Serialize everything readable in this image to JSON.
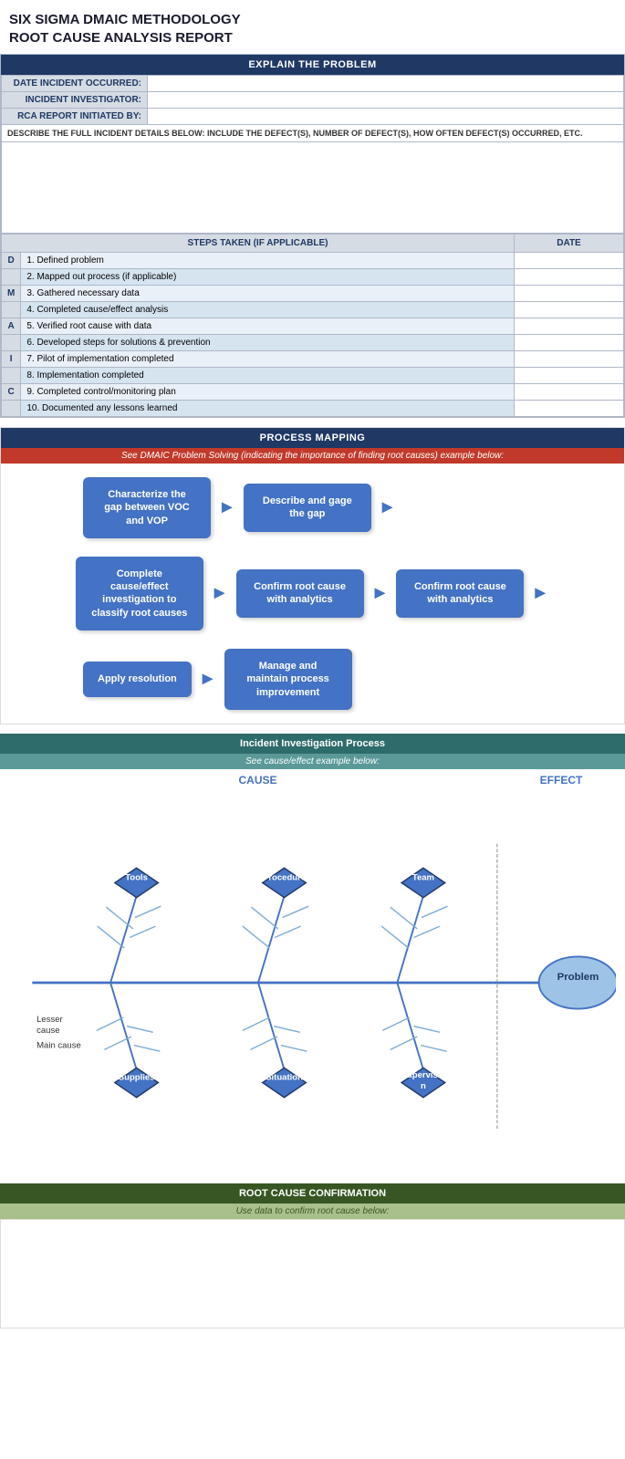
{
  "title": {
    "line1": "SIX SIGMA DMAIC METHODOLOGY",
    "line2": "ROOT CAUSE ANALYSIS REPORT"
  },
  "explain_section": {
    "header": "EXPLAIN THE PROBLEM",
    "fields": [
      {
        "label": "DATE INCIDENT OCCURRED:",
        "value": ""
      },
      {
        "label": "INCIDENT INVESTIGATOR:",
        "value": ""
      },
      {
        "label": "RCA REPORT INITIATED BY:",
        "value": ""
      }
    ],
    "description_label": "DESCRIBE THE FULL INCIDENT DETAILS BELOW: INCLUDE THE DEFECT(S), NUMBER OF DEFECT(S), HOW OFTEN DEFECT(S) OCCURRED, ETC."
  },
  "steps_section": {
    "col1": "STEPS TAKEN (IF APPLICABLE)",
    "col2": "DATE",
    "steps": [
      {
        "phase": "D",
        "text": "1. Defined problem",
        "date": ""
      },
      {
        "phase": "",
        "text": "2. Mapped out process (if applicable)",
        "date": ""
      },
      {
        "phase": "M",
        "text": "3. Gathered necessary data",
        "date": ""
      },
      {
        "phase": "",
        "text": "4. Completed cause/effect analysis",
        "date": ""
      },
      {
        "phase": "A",
        "text": "5. Verified root cause with data",
        "date": ""
      },
      {
        "phase": "",
        "text": "6. Developed steps for solutions & prevention",
        "date": ""
      },
      {
        "phase": "I",
        "text": "7. Pilot of implementation completed",
        "date": ""
      },
      {
        "phase": "",
        "text": "8. Implementation completed",
        "date": ""
      },
      {
        "phase": "C",
        "text": "9. Completed control/monitoring plan",
        "date": ""
      },
      {
        "phase": "",
        "text": "10. Documented any lessons learned",
        "date": ""
      }
    ]
  },
  "process_mapping": {
    "header": "PROCESS MAPPING",
    "subheader": "See DMAIC Problem Solving (indicating the importance of finding root causes) example below:",
    "row1": [
      {
        "text": "Characterize the gap between VOC and VOP"
      },
      {
        "text": "Describe and gage the gap"
      }
    ],
    "row2": [
      {
        "text": "Complete cause/effect investigation to classify root causes"
      },
      {
        "text": "Confirm root cause with analytics"
      },
      {
        "text": "Confirm root cause with analytics"
      }
    ],
    "row3": [
      {
        "text": "Apply resolution"
      },
      {
        "text": "Manage and maintain process improvement"
      }
    ]
  },
  "incident_section": {
    "header": "Incident Investigation Process",
    "subheader": "See cause/effect example below:",
    "cause_label": "CAUSE",
    "effect_label": "EFFECT",
    "nodes": [
      "Tools",
      "Procedure",
      "Team",
      "Supplies",
      "Situation",
      "Supervision"
    ],
    "problem": "Problem",
    "annotations": [
      "Lesser cause",
      "Main cause"
    ]
  },
  "rca_section": {
    "header": "ROOT CAUSE CONFIRMATION",
    "subheader": "Use data to confirm root cause below:"
  }
}
